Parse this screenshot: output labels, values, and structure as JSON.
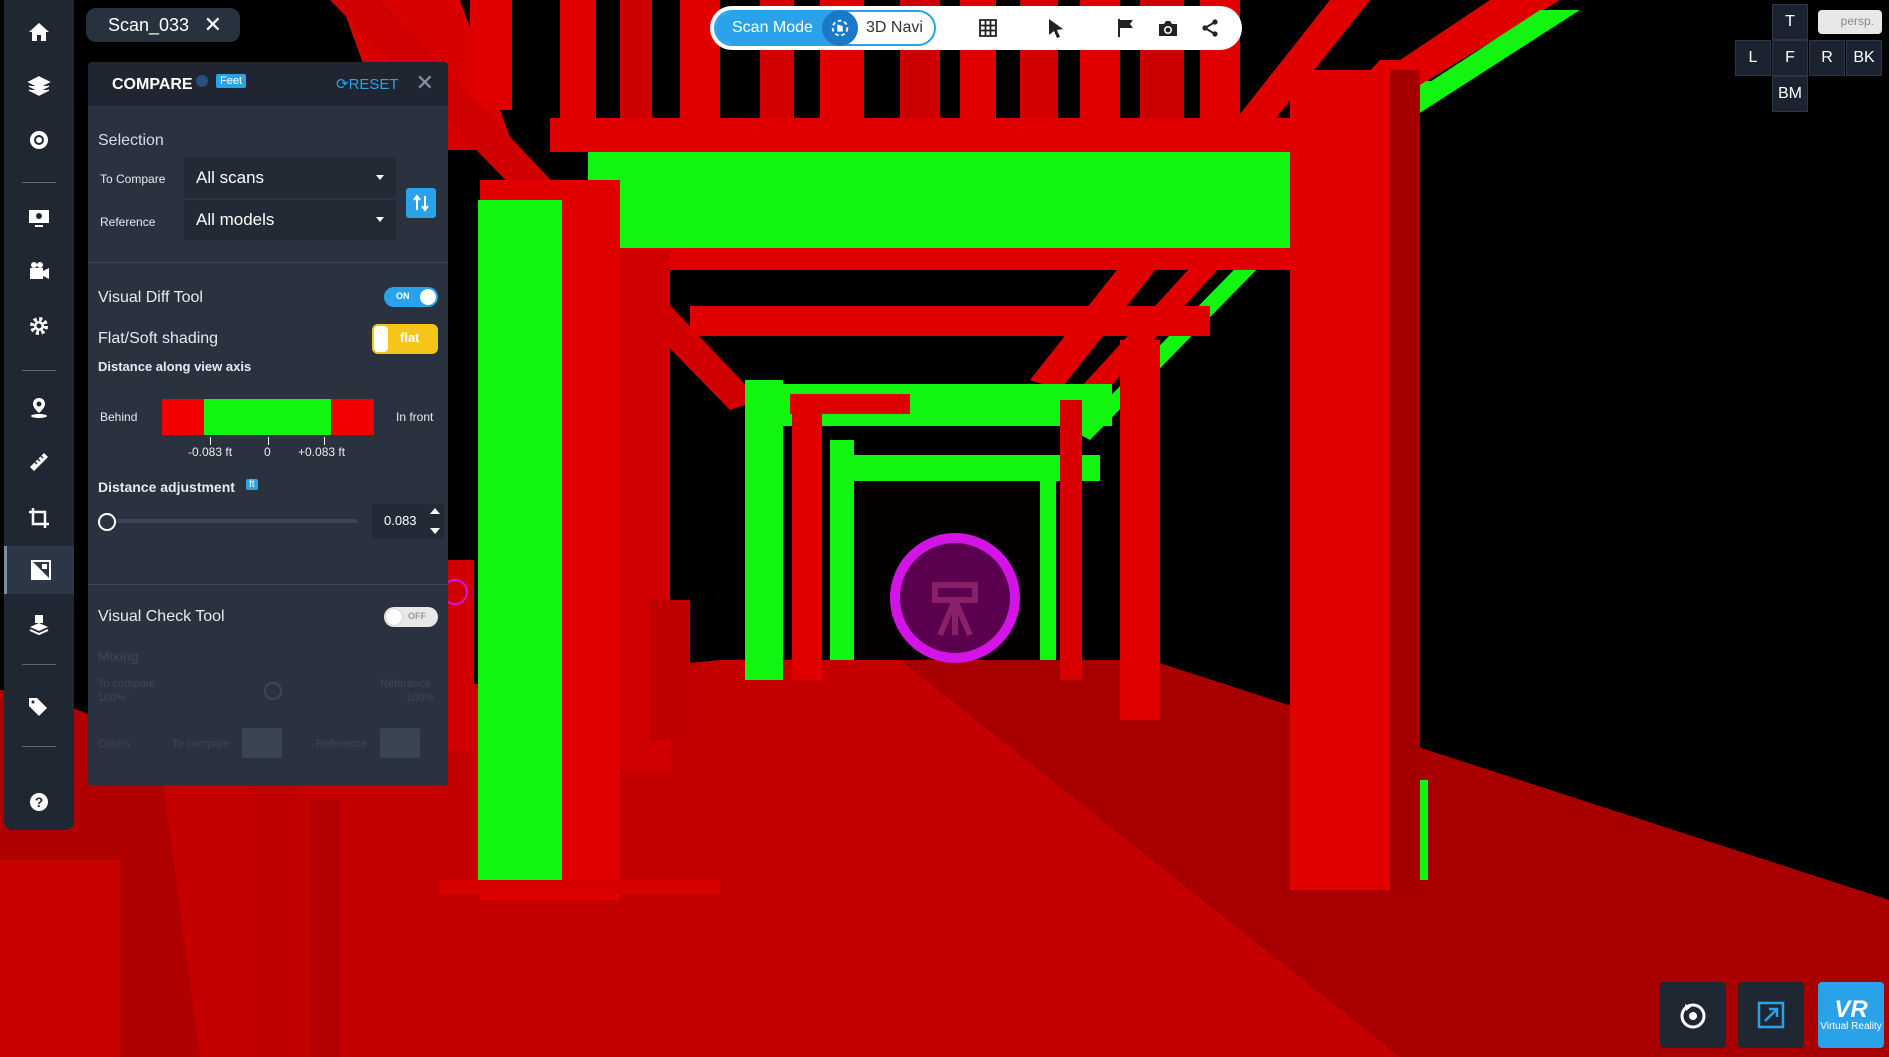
{
  "scan_tab": {
    "label": "Scan_033",
    "close": "✕"
  },
  "top_bar": {
    "scan_mode": "Scan Mode",
    "nav_mode": "3D Navi"
  },
  "view_cube": {
    "top": "T",
    "left": "L",
    "front": "F",
    "right": "R",
    "back": "BK",
    "bottom": "BM",
    "projection": "persp."
  },
  "compare": {
    "title": "COMPARE",
    "unit_badge": "Feet",
    "reset": "RESET",
    "close": "✕",
    "selection_label": "Selection",
    "to_compare_label": "To Compare",
    "to_compare_value": "All scans",
    "reference_label": "Reference",
    "reference_value": "All models",
    "visual_diff_label": "Visual Diff Tool",
    "visual_diff_state": "ON",
    "shading_label": "Flat/Soft shading",
    "shading_value": "flat",
    "distance_axis_label": "Distance along view axis",
    "behind_label": "Behind",
    "in_front_label": "In front",
    "ticks": [
      "-0.083 ft",
      "0",
      "+0.083 ft"
    ],
    "distance_adjustment_label": "Distance adjustment",
    "distance_unit_badge": "ft",
    "distance_value": "0.083",
    "slider_level": 0,
    "visual_check_label": "Visual Check Tool",
    "visual_check_state": "OFF",
    "disabled": {
      "mixing_label": "Mixing",
      "to_compare_label": "To compare",
      "to_compare_pct": "100%",
      "reference_label": "Reference",
      "reference_pct": "100%",
      "colors_label": "Colors",
      "colors_to_compare": "To compare",
      "colors_reference": "Reference"
    }
  },
  "vr": {
    "big": "VR",
    "small": "Virtual Reality"
  },
  "colors": {
    "accent": "#2aa2ea",
    "scan_red": "#e00000",
    "scan_green": "#11f511",
    "toggle_flat": "#f5c518",
    "marker": "#d414e6",
    "panel_bg": "#2a323f"
  }
}
